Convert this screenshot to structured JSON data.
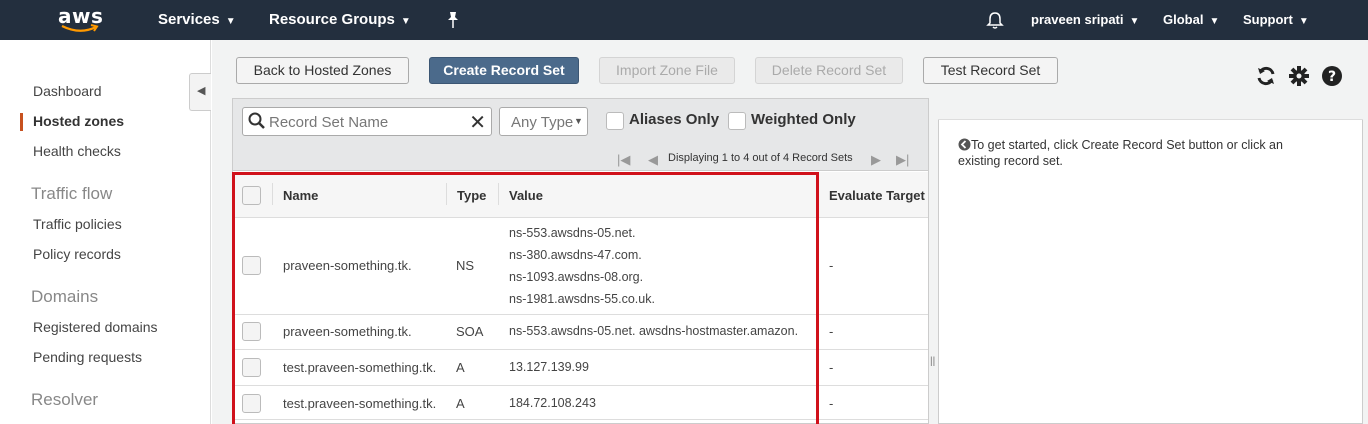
{
  "topnav": {
    "logo_text": "aws",
    "services": "Services",
    "resource_groups": "Resource Groups",
    "user": "praveen sripati",
    "region": "Global",
    "support": "Support"
  },
  "sidebar": {
    "dashboard": "Dashboard",
    "hosted_zones": "Hosted zones",
    "health_checks": "Health checks",
    "traffic_flow": "Traffic flow",
    "traffic_policies": "Traffic policies",
    "policy_records": "Policy records",
    "domains": "Domains",
    "registered_domains": "Registered domains",
    "pending_requests": "Pending requests",
    "resolver": "Resolver"
  },
  "toolbar": {
    "back": "Back to Hosted Zones",
    "create": "Create Record Set",
    "import": "Import Zone File",
    "delete": "Delete Record Set",
    "test": "Test Record Set"
  },
  "filters": {
    "search_placeholder": "Record Set Name",
    "type_value": "Any Type",
    "aliases_only": "Aliases Only",
    "weighted_only": "Weighted Only",
    "pager_text": "Displaying 1 to 4 out of 4 Record Sets"
  },
  "table": {
    "headers": {
      "name": "Name",
      "type": "Type",
      "value": "Value",
      "evaluate": "Evaluate Target"
    },
    "rows": [
      {
        "name": "praveen-something.tk.",
        "type": "NS",
        "values": [
          "ns-553.awsdns-05.net.",
          "ns-380.awsdns-47.com.",
          "ns-1093.awsdns-08.org.",
          "ns-1981.awsdns-55.co.uk."
        ],
        "evaluate": "-"
      },
      {
        "name": "praveen-something.tk.",
        "type": "SOA",
        "values": [
          "ns-553.awsdns-05.net. awsdns-hostmaster.amazon."
        ],
        "evaluate": "-"
      },
      {
        "name": "test.praveen-something.tk.",
        "type": "A",
        "values": [
          "13.127.139.99"
        ],
        "evaluate": "-"
      },
      {
        "name": "test.praveen-something.tk.",
        "type": "A",
        "values": [
          "184.72.108.243"
        ],
        "evaluate": "-"
      }
    ]
  },
  "info": {
    "text": "To get started, click Create Record Set button or click an existing record set."
  },
  "colors": {
    "nav_bg": "#232f3e",
    "primary_button": "#4b6a8b",
    "highlight_box": "#d0111b",
    "accent": "#ff9900"
  },
  "icons": [
    "chevron-down-icon",
    "pin-icon",
    "bell-icon",
    "refresh-icon",
    "gear-icon",
    "help-icon",
    "search-icon",
    "clear-icon",
    "info-icon",
    "first-page-icon",
    "prev-page-icon",
    "next-page-icon",
    "last-page-icon",
    "collapse-icon"
  ]
}
